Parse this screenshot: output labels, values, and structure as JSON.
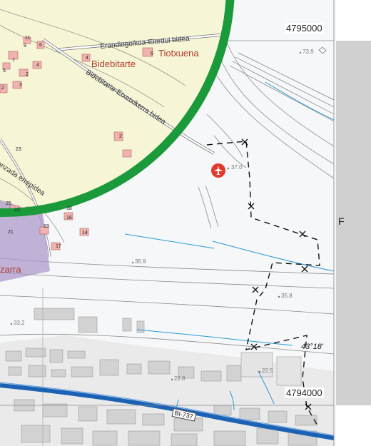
{
  "grid": {
    "northing_top": "4795000",
    "northing_bottom": "4794000",
    "column_letter": "F",
    "latitude": "43°18'"
  },
  "places": {
    "tiotxuena": "Tiotxuena",
    "bidebitarte": "Bidebitarte",
    "zarra": "zarra"
  },
  "roads": {
    "erandiogoikoa": "Erandiogoikoa-Elordui bidea",
    "bidebitarte_etxe": "Bidebitarte-Etxetxikerra bidea",
    "errepidea": "anzada errepidea",
    "bi737": "BI-737"
  },
  "elevations": [
    "73.9",
    "37.0",
    "35.9",
    "35.8",
    "33.2",
    "22.8",
    "22.5"
  ],
  "building_numbers": [
    "11",
    "9",
    "6",
    "4",
    "7",
    "5",
    "2",
    "3",
    "2",
    "4",
    "6",
    "2",
    "23",
    "25",
    "21",
    "18",
    "16",
    "14",
    "19",
    "17",
    "23"
  ],
  "colors": {
    "inset_fill": "#f6f6d6",
    "inset_ring": "#1a9a3a",
    "water": "#2a9ad4",
    "highway": "#1c62b4",
    "building": "#f0b3b0",
    "boundary": "#111111",
    "margin": "#d0d0d0"
  },
  "icons": [
    "airport-icon"
  ]
}
